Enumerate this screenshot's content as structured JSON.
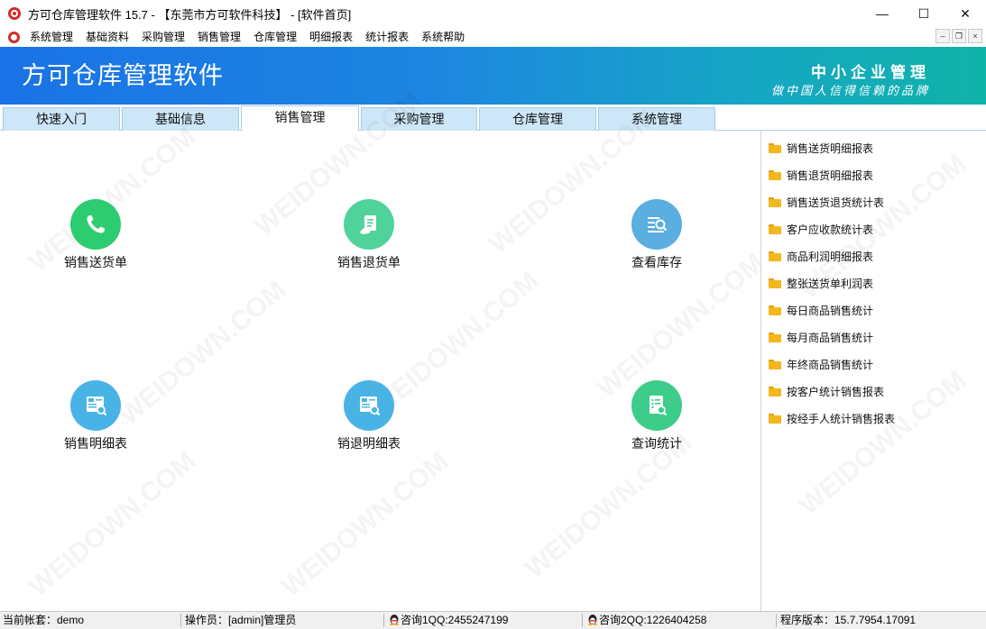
{
  "window": {
    "title": "方可仓库管理软件 15.7 - 【东莞市方可软件科技】 - [软件首页]",
    "minimize_glyph": "—",
    "maximize_glyph": "☐",
    "close_glyph": "✕"
  },
  "menu": {
    "items": [
      "系统管理",
      "基础资料",
      "采购管理",
      "销售管理",
      "仓库管理",
      "明细报表",
      "统计报表",
      "系统帮助"
    ],
    "mdi_min": "–",
    "mdi_restore": "❐",
    "mdi_close": "×"
  },
  "banner": {
    "title": "方可仓库管理软件",
    "slogan_line1": "中小企业管理",
    "slogan_line2": "做中国人信得信赖的品牌"
  },
  "tabs": {
    "items": [
      "快速入门",
      "基础信息",
      "销售管理",
      "采购管理",
      "仓库管理",
      "系统管理"
    ],
    "active_index": 2
  },
  "tiles": [
    {
      "label": "销售送货单",
      "icon": "phone-icon",
      "color": "#2ecc71"
    },
    {
      "label": "销售退货单",
      "icon": "document-hand-icon",
      "color": "#4fd39a"
    },
    {
      "label": "查看库存",
      "icon": "inventory-search-icon",
      "color": "#5aaee0"
    },
    {
      "label": "销售明细表",
      "icon": "job-list-icon",
      "color": "#4ab3e6"
    },
    {
      "label": "销退明细表",
      "icon": "job-list-icon",
      "color": "#4ab3e6"
    },
    {
      "label": "查询统计",
      "icon": "report-search-icon",
      "color": "#3dcc8a"
    }
  ],
  "reports": [
    "销售送货明细报表",
    "销售退货明细报表",
    "销售送货退货统计表",
    "客户应收款统计表",
    "商品利润明细报表",
    "整张送货单利润表",
    "每日商品销售统计",
    "每月商品销售统计",
    "年终商品销售统计",
    "按客户统计销售报表",
    "按经手人统计销售报表"
  ],
  "watermark_text": "WEIDOWN.COM",
  "status": {
    "account": "当前帐套：demo",
    "operator": "操作员：[admin]管理员",
    "qq1": "咨询1QQ:2455247199",
    "qq2": "咨询2QQ:1226404258",
    "version": "程序版本：15.7.7954.17091"
  },
  "colors": {
    "banner_start": "#1a72e6",
    "banner_end": "#0fb3a8",
    "tab_bg": "#cde6f8",
    "folder": "#f4b71d"
  }
}
